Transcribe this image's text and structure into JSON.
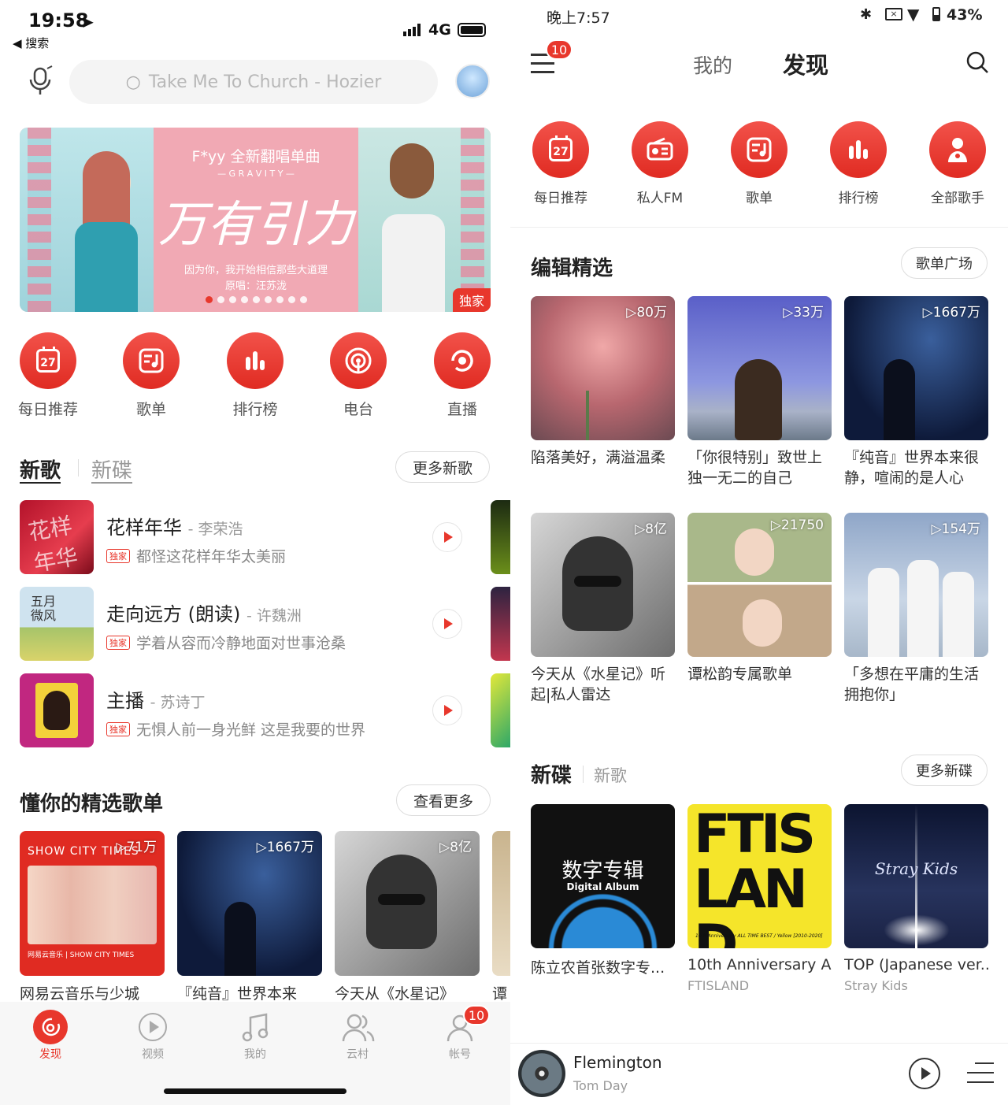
{
  "left": {
    "status": {
      "time": "19:58",
      "back_label": "◀ 搜索",
      "network": "4G"
    },
    "search": {
      "placeholder": "Take Me To Church - Hozier"
    },
    "banner": {
      "artist_line": "F*yy 全新翻唱单曲",
      "subtitle": "— G R A V I T Y —",
      "title": "万有引力",
      "caption": "因为你，我开始相信那些大道理",
      "credit": "原唱：汪苏泷",
      "exclusive": "独家",
      "dots": 9,
      "active_dot": 0
    },
    "quick": [
      {
        "label": "每日推荐",
        "icon": "calendar-icon",
        "day": "27"
      },
      {
        "label": "歌单",
        "icon": "playlist-icon"
      },
      {
        "label": "排行榜",
        "icon": "chart-icon"
      },
      {
        "label": "电台",
        "icon": "radio-icon"
      },
      {
        "label": "直播",
        "icon": "live-icon"
      }
    ],
    "songs_section": {
      "tab_active": "新歌",
      "tab_inactive": "新碟",
      "more": "更多新歌"
    },
    "songs": [
      {
        "title": "花样年华",
        "artist": "- 李荣浩",
        "tag": "独家",
        "desc": "都怪这花样年华太美丽"
      },
      {
        "title": "走向远方 (朗读)",
        "artist": "- 许魏洲",
        "tag": "独家",
        "desc": "学着从容而冷静地面对世事沧桑"
      },
      {
        "title": "主播",
        "artist": "- 苏诗丁",
        "tag": "独家",
        "desc": "无惧人前一身光鲜 这是我要的世界"
      }
    ],
    "playlists_section": {
      "title": "懂你的精选歌单",
      "more": "查看更多"
    },
    "playlists": [
      {
        "count": "▷71万",
        "title": "网易云音乐与少城",
        "art_text": "SHOW CITY TIMES",
        "art_footer": "网易云音乐 | SHOW CITY TIMES"
      },
      {
        "count": "▷1667万",
        "title": "『纯音』世界本来"
      },
      {
        "count": "▷8亿",
        "title": "今天从《水星记》"
      },
      {
        "count": "",
        "title": "谭"
      }
    ],
    "tabbar": [
      {
        "label": "发现",
        "icon": "netease-logo-icon",
        "active": true
      },
      {
        "label": "视频",
        "icon": "video-icon"
      },
      {
        "label": "我的",
        "icon": "music-note-icon"
      },
      {
        "label": "云村",
        "icon": "community-icon"
      },
      {
        "label": "帐号",
        "icon": "account-icon",
        "badge": "10"
      }
    ]
  },
  "right": {
    "status": {
      "time": "晚上7:57",
      "battery": "43%"
    },
    "header": {
      "badge": "10",
      "tab_mine": "我的",
      "tab_discover": "发现"
    },
    "quick": [
      {
        "label": "每日推荐",
        "icon": "calendar-icon",
        "day": "27"
      },
      {
        "label": "私人FM",
        "icon": "radio-fm-icon"
      },
      {
        "label": "歌单",
        "icon": "playlist-icon"
      },
      {
        "label": "排行榜",
        "icon": "chart-icon"
      },
      {
        "label": "全部歌手",
        "icon": "singer-icon"
      }
    ],
    "editor_section": {
      "title": "编辑精选",
      "more": "歌单广场"
    },
    "editor": [
      {
        "count": "▷80万",
        "title": "陷落美好，满溢温柔"
      },
      {
        "count": "▷33万",
        "title": "「你很特别」致世上独一无二的自己"
      },
      {
        "count": "▷1667万",
        "title": "『纯音』世界本来很静，喧闹的是人心"
      },
      {
        "count": "▷8亿",
        "title": "今天从《水星记》听起|私人雷达"
      },
      {
        "count": "▷21750",
        "title": "谭松韵专属歌单"
      },
      {
        "count": "▷154万",
        "title": "「多想在平庸的生活拥抱你」"
      }
    ],
    "albums_section": {
      "tab_active": "新碟",
      "tab_inactive": "新歌",
      "more": "更多新碟"
    },
    "albums": [
      {
        "title": "陈立农首张数字专...",
        "artist": "",
        "art_title": "数字专辑",
        "art_sub": "Digital Album"
      },
      {
        "title": "10th Anniversary A...",
        "artist": "FTISLAND",
        "art_title": "FTIS LAND",
        "art_sub": "10th Anniversary ALL TIME BEST / Yellow [2010-2020]"
      },
      {
        "title": "TOP (Japanese ver...",
        "artist": "Stray Kids",
        "art_title": "Stray Kids",
        "art_sub": ""
      }
    ],
    "player": {
      "song": "Flemington",
      "artist": "Tom Day"
    }
  },
  "colors": {
    "accent": "#e8372c",
    "banner_pink": "#f1a9b4"
  }
}
